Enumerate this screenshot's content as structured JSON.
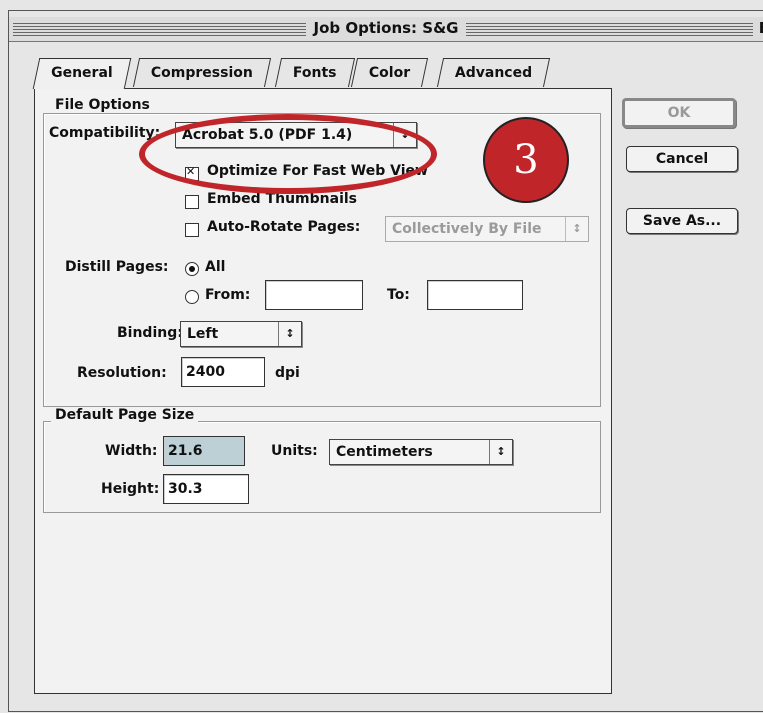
{
  "window": {
    "title": "Job Options: S&G",
    "zoom_glyph": "E"
  },
  "tabs": [
    {
      "label": "General",
      "active": true
    },
    {
      "label": "Compression",
      "active": false
    },
    {
      "label": "Fonts",
      "active": false
    },
    {
      "label": "Color",
      "active": false
    },
    {
      "label": "Advanced",
      "active": false
    }
  ],
  "file_options": {
    "title": "File Options",
    "compatibility_label": "Compatibility:",
    "compatibility_value": "Acrobat 5.0 (PDF 1.4)",
    "optimize_label": "Optimize For Fast Web View",
    "optimize_checked": true,
    "thumbnails_label": "Embed Thumbnails",
    "thumbnails_checked": false,
    "autorotate_label": "Auto-Rotate Pages:",
    "autorotate_checked": false,
    "autorotate_value": "Collectively By File",
    "distill_label": "Distill Pages:",
    "all_label": "All",
    "from_label": "From:",
    "from_value": "",
    "to_label": "To:",
    "to_value": "",
    "binding_label": "Binding:",
    "binding_value": "Left",
    "resolution_label": "Resolution:",
    "resolution_value": "2400",
    "resolution_unit": "dpi"
  },
  "page_size": {
    "title": "Default Page Size",
    "width_label": "Width:",
    "width_value": "21.6",
    "units_label": "Units:",
    "units_value": "Centimeters",
    "height_label": "Height:",
    "height_value": "30.3"
  },
  "buttons": {
    "ok": "OK",
    "cancel": "Cancel",
    "save_as": "Save As..."
  },
  "annotation": {
    "step_number": "3",
    "color": "#c0252a"
  }
}
